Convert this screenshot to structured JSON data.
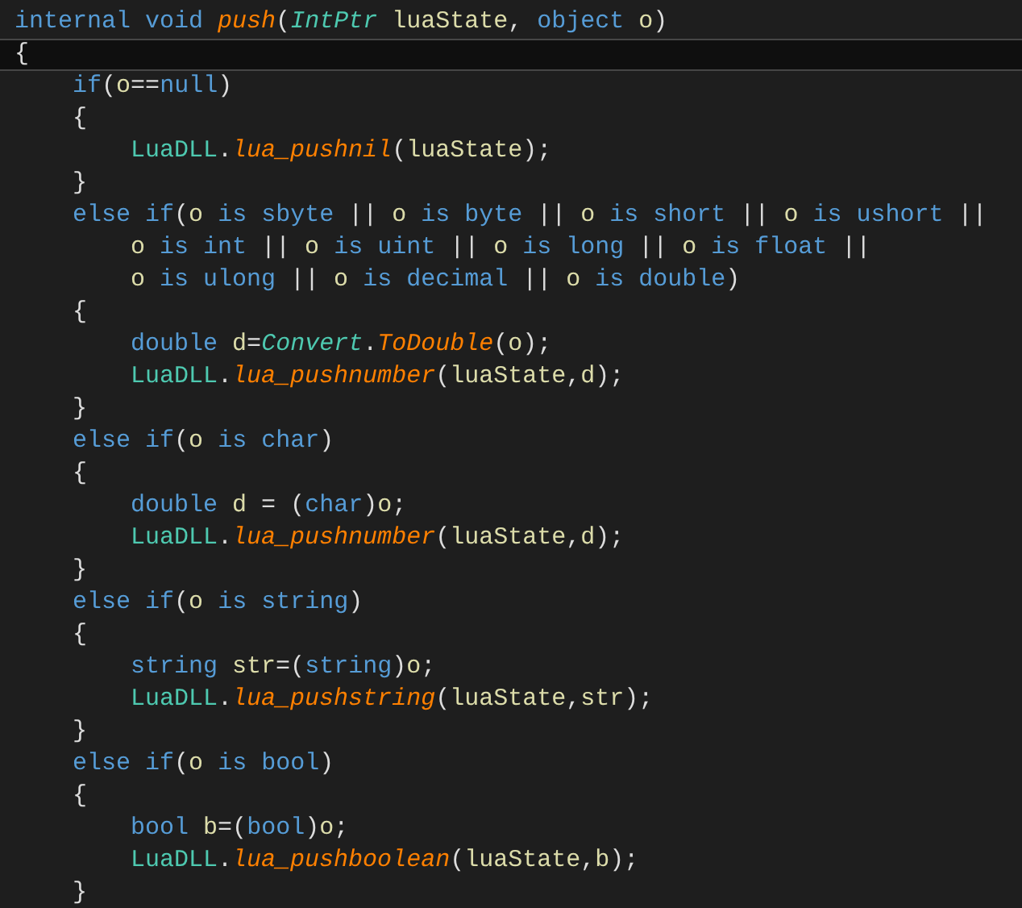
{
  "editor": {
    "lines": [
      {
        "current": false,
        "tokens": [
          {
            "kind": "keyword",
            "text": "internal void "
          },
          {
            "kind": "method",
            "text": "push"
          },
          {
            "kind": "plain",
            "text": "("
          },
          {
            "kind": "type",
            "text": "IntPtr"
          },
          {
            "kind": "ident",
            "text": " luaState"
          },
          {
            "kind": "plain",
            "text": ", "
          },
          {
            "kind": "keyword",
            "text": "object "
          },
          {
            "kind": "ident",
            "text": "o"
          },
          {
            "kind": "plain",
            "text": ")"
          }
        ]
      },
      {
        "current": true,
        "tokens": [
          {
            "kind": "plain",
            "text": "{"
          }
        ]
      },
      {
        "current": false,
        "tokens": [
          {
            "kind": "keyword",
            "text": "    if"
          },
          {
            "kind": "plain",
            "text": "("
          },
          {
            "kind": "ident",
            "text": "o"
          },
          {
            "kind": "plain",
            "text": "=="
          },
          {
            "kind": "keyword",
            "text": "null"
          },
          {
            "kind": "plain",
            "text": ")"
          }
        ]
      },
      {
        "current": false,
        "tokens": [
          {
            "kind": "plain",
            "text": "    {"
          }
        ]
      },
      {
        "current": false,
        "tokens": [
          {
            "kind": "class",
            "text": "        LuaDLL"
          },
          {
            "kind": "plain",
            "text": "."
          },
          {
            "kind": "method",
            "text": "lua_pushnil"
          },
          {
            "kind": "plain",
            "text": "("
          },
          {
            "kind": "ident",
            "text": "luaState"
          },
          {
            "kind": "plain",
            "text": ");"
          }
        ]
      },
      {
        "current": false,
        "tokens": [
          {
            "kind": "plain",
            "text": "    }"
          }
        ]
      },
      {
        "current": false,
        "tokens": [
          {
            "kind": "keyword",
            "text": "    else if"
          },
          {
            "kind": "plain",
            "text": "("
          },
          {
            "kind": "ident",
            "text": "o "
          },
          {
            "kind": "keyword",
            "text": "is sbyte "
          },
          {
            "kind": "plain",
            "text": "|| "
          },
          {
            "kind": "ident",
            "text": "o "
          },
          {
            "kind": "keyword",
            "text": "is byte "
          },
          {
            "kind": "plain",
            "text": "|| "
          },
          {
            "kind": "ident",
            "text": "o "
          },
          {
            "kind": "keyword",
            "text": "is short "
          },
          {
            "kind": "plain",
            "text": "|| "
          },
          {
            "kind": "ident",
            "text": "o "
          },
          {
            "kind": "keyword",
            "text": "is ushort "
          },
          {
            "kind": "plain",
            "text": "||"
          }
        ]
      },
      {
        "current": false,
        "tokens": [
          {
            "kind": "ident",
            "text": "        o "
          },
          {
            "kind": "keyword",
            "text": "is int "
          },
          {
            "kind": "plain",
            "text": "|| "
          },
          {
            "kind": "ident",
            "text": "o "
          },
          {
            "kind": "keyword",
            "text": "is uint "
          },
          {
            "kind": "plain",
            "text": "|| "
          },
          {
            "kind": "ident",
            "text": "o "
          },
          {
            "kind": "keyword",
            "text": "is long "
          },
          {
            "kind": "plain",
            "text": "|| "
          },
          {
            "kind": "ident",
            "text": "o "
          },
          {
            "kind": "keyword",
            "text": "is float "
          },
          {
            "kind": "plain",
            "text": "||"
          }
        ]
      },
      {
        "current": false,
        "tokens": [
          {
            "kind": "ident",
            "text": "        o "
          },
          {
            "kind": "keyword",
            "text": "is ulong "
          },
          {
            "kind": "plain",
            "text": "|| "
          },
          {
            "kind": "ident",
            "text": "o "
          },
          {
            "kind": "keyword",
            "text": "is decimal "
          },
          {
            "kind": "plain",
            "text": "|| "
          },
          {
            "kind": "ident",
            "text": "o "
          },
          {
            "kind": "keyword",
            "text": "is double"
          },
          {
            "kind": "plain",
            "text": ")"
          }
        ]
      },
      {
        "current": false,
        "tokens": [
          {
            "kind": "plain",
            "text": "    {"
          }
        ]
      },
      {
        "current": false,
        "tokens": [
          {
            "kind": "keyword",
            "text": "        double "
          },
          {
            "kind": "ident",
            "text": "d"
          },
          {
            "kind": "plain",
            "text": "="
          },
          {
            "kind": "type",
            "text": "Convert"
          },
          {
            "kind": "plain",
            "text": "."
          },
          {
            "kind": "method",
            "text": "ToDouble"
          },
          {
            "kind": "plain",
            "text": "("
          },
          {
            "kind": "ident",
            "text": "o"
          },
          {
            "kind": "plain",
            "text": ");"
          }
        ]
      },
      {
        "current": false,
        "tokens": [
          {
            "kind": "class",
            "text": "        LuaDLL"
          },
          {
            "kind": "plain",
            "text": "."
          },
          {
            "kind": "method",
            "text": "lua_pushnumber"
          },
          {
            "kind": "plain",
            "text": "("
          },
          {
            "kind": "ident",
            "text": "luaState"
          },
          {
            "kind": "plain",
            "text": ","
          },
          {
            "kind": "ident",
            "text": "d"
          },
          {
            "kind": "plain",
            "text": ");"
          }
        ]
      },
      {
        "current": false,
        "tokens": [
          {
            "kind": "plain",
            "text": "    }"
          }
        ]
      },
      {
        "current": false,
        "tokens": [
          {
            "kind": "keyword",
            "text": "    else if"
          },
          {
            "kind": "plain",
            "text": "("
          },
          {
            "kind": "ident",
            "text": "o "
          },
          {
            "kind": "keyword",
            "text": "is char"
          },
          {
            "kind": "plain",
            "text": ")"
          }
        ]
      },
      {
        "current": false,
        "tokens": [
          {
            "kind": "plain",
            "text": "    {"
          }
        ]
      },
      {
        "current": false,
        "tokens": [
          {
            "kind": "keyword",
            "text": "        double "
          },
          {
            "kind": "ident",
            "text": "d "
          },
          {
            "kind": "plain",
            "text": "= ("
          },
          {
            "kind": "keyword",
            "text": "char"
          },
          {
            "kind": "plain",
            "text": ")"
          },
          {
            "kind": "ident",
            "text": "o"
          },
          {
            "kind": "plain",
            "text": ";"
          }
        ]
      },
      {
        "current": false,
        "tokens": [
          {
            "kind": "class",
            "text": "        LuaDLL"
          },
          {
            "kind": "plain",
            "text": "."
          },
          {
            "kind": "method",
            "text": "lua_pushnumber"
          },
          {
            "kind": "plain",
            "text": "("
          },
          {
            "kind": "ident",
            "text": "luaState"
          },
          {
            "kind": "plain",
            "text": ","
          },
          {
            "kind": "ident",
            "text": "d"
          },
          {
            "kind": "plain",
            "text": ");"
          }
        ]
      },
      {
        "current": false,
        "tokens": [
          {
            "kind": "plain",
            "text": "    }"
          }
        ]
      },
      {
        "current": false,
        "tokens": [
          {
            "kind": "keyword",
            "text": "    else if"
          },
          {
            "kind": "plain",
            "text": "("
          },
          {
            "kind": "ident",
            "text": "o "
          },
          {
            "kind": "keyword",
            "text": "is string"
          },
          {
            "kind": "plain",
            "text": ")"
          }
        ]
      },
      {
        "current": false,
        "tokens": [
          {
            "kind": "plain",
            "text": "    {"
          }
        ]
      },
      {
        "current": false,
        "tokens": [
          {
            "kind": "keyword",
            "text": "        string "
          },
          {
            "kind": "ident",
            "text": "str"
          },
          {
            "kind": "plain",
            "text": "=("
          },
          {
            "kind": "keyword",
            "text": "string"
          },
          {
            "kind": "plain",
            "text": ")"
          },
          {
            "kind": "ident",
            "text": "o"
          },
          {
            "kind": "plain",
            "text": ";"
          }
        ]
      },
      {
        "current": false,
        "tokens": [
          {
            "kind": "class",
            "text": "        LuaDLL"
          },
          {
            "kind": "plain",
            "text": "."
          },
          {
            "kind": "method",
            "text": "lua_pushstring"
          },
          {
            "kind": "plain",
            "text": "("
          },
          {
            "kind": "ident",
            "text": "luaState"
          },
          {
            "kind": "plain",
            "text": ","
          },
          {
            "kind": "ident",
            "text": "str"
          },
          {
            "kind": "plain",
            "text": ");"
          }
        ]
      },
      {
        "current": false,
        "tokens": [
          {
            "kind": "plain",
            "text": "    }"
          }
        ]
      },
      {
        "current": false,
        "tokens": [
          {
            "kind": "keyword",
            "text": "    else if"
          },
          {
            "kind": "plain",
            "text": "("
          },
          {
            "kind": "ident",
            "text": "o "
          },
          {
            "kind": "keyword",
            "text": "is bool"
          },
          {
            "kind": "plain",
            "text": ")"
          }
        ]
      },
      {
        "current": false,
        "tokens": [
          {
            "kind": "plain",
            "text": "    {"
          }
        ]
      },
      {
        "current": false,
        "tokens": [
          {
            "kind": "keyword",
            "text": "        bool "
          },
          {
            "kind": "ident",
            "text": "b"
          },
          {
            "kind": "plain",
            "text": "=("
          },
          {
            "kind": "keyword",
            "text": "bool"
          },
          {
            "kind": "plain",
            "text": ")"
          },
          {
            "kind": "ident",
            "text": "o"
          },
          {
            "kind": "plain",
            "text": ";"
          }
        ]
      },
      {
        "current": false,
        "tokens": [
          {
            "kind": "class",
            "text": "        LuaDLL"
          },
          {
            "kind": "plain",
            "text": "."
          },
          {
            "kind": "method",
            "text": "lua_pushboolean"
          },
          {
            "kind": "plain",
            "text": "("
          },
          {
            "kind": "ident",
            "text": "luaState"
          },
          {
            "kind": "plain",
            "text": ","
          },
          {
            "kind": "ident",
            "text": "b"
          },
          {
            "kind": "plain",
            "text": ");"
          }
        ]
      },
      {
        "current": false,
        "tokens": [
          {
            "kind": "plain",
            "text": "    }"
          }
        ]
      }
    ]
  }
}
